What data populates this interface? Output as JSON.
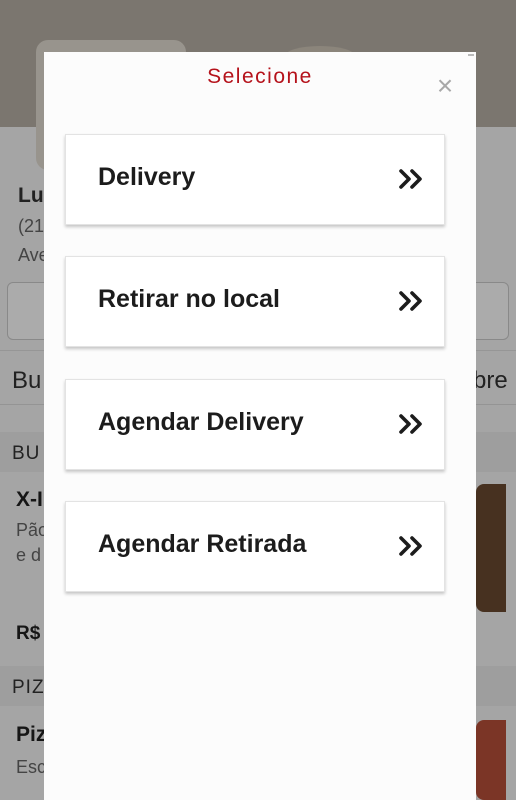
{
  "background": {
    "store_name": "Lu",
    "store_phone": "(21",
    "store_address": "Ave",
    "tabs": {
      "left": "Bu",
      "right": "bre"
    },
    "sections": [
      {
        "title": "BU",
        "item_name": "X-I",
        "item_desc_1": "Pão",
        "item_desc_2": "e d",
        "item_price": "R$"
      },
      {
        "title": "PIZ",
        "item_name": "Piz",
        "item_desc_1": "Esc"
      }
    ]
  },
  "modal": {
    "title": "Selecione",
    "close_symbol": "×",
    "options": [
      {
        "label": "Delivery"
      },
      {
        "label": "Retirar no local"
      },
      {
        "label": "Agendar Delivery"
      },
      {
        "label": "Agendar Retirada"
      }
    ]
  },
  "colors": {
    "title": "#b5121b",
    "option_text": "#1c1c1c",
    "close_icon": "#a8a8a8"
  },
  "icons": {
    "option_arrow": "double-chevron-right-icon",
    "close": "close-icon"
  }
}
